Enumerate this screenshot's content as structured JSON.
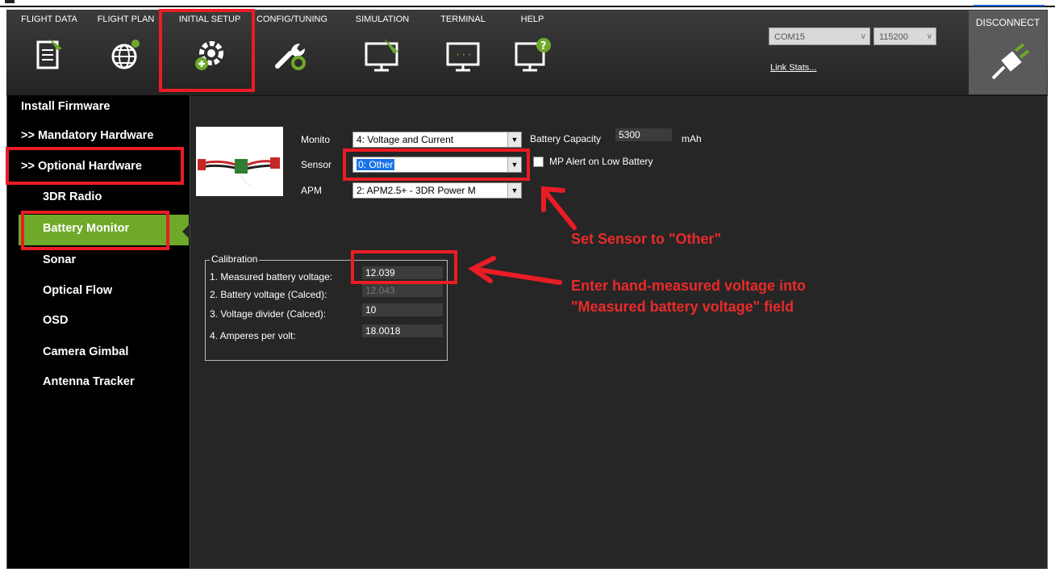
{
  "toolbar": {
    "items": [
      {
        "label": "FLIGHT DATA",
        "icon": "flight-data-icon"
      },
      {
        "label": "FLIGHT PLAN",
        "icon": "flight-plan-icon"
      },
      {
        "label": "INITIAL SETUP",
        "icon": "initial-setup-icon"
      },
      {
        "label": "CONFIG/TUNING",
        "icon": "config-tuning-icon"
      },
      {
        "label": "SIMULATION",
        "icon": "simulation-icon"
      },
      {
        "label": "TERMINAL",
        "icon": "terminal-icon"
      },
      {
        "label": "HELP",
        "icon": "help-icon"
      }
    ],
    "port": "COM15",
    "baud": "115200",
    "link_stats": "Link Stats...",
    "disconnect": "DISCONNECT"
  },
  "sidebar": {
    "items": [
      {
        "label": "Install Firmware"
      },
      {
        "label": ">> Mandatory Hardware"
      },
      {
        "label": ">> Optional Hardware"
      },
      {
        "label": "3DR Radio"
      },
      {
        "label": "Battery Monitor",
        "active": true
      },
      {
        "label": "Sonar"
      },
      {
        "label": "Optical Flow"
      },
      {
        "label": "OSD"
      },
      {
        "label": "Camera Gimbal"
      },
      {
        "label": "Antenna Tracker"
      }
    ]
  },
  "battery": {
    "monitor_label": "Monito",
    "monitor_value": "4: Voltage and Current",
    "sensor_label": "Sensor",
    "sensor_value": "0: Other",
    "apm_label": "APM",
    "apm_value": "2: APM2.5+ - 3DR Power M",
    "capacity_label": "Battery Capacity",
    "capacity_value": "5300",
    "capacity_unit": "mAh",
    "alert_label": "MP Alert on Low Battery",
    "alert_checked": false
  },
  "calibration": {
    "title": "Calibration",
    "rows": [
      {
        "label": "1. Measured battery voltage:",
        "value": "12.039"
      },
      {
        "label": "2. Battery voltage (Calced):",
        "value": "12.043"
      },
      {
        "label": "3. Voltage divider (Calced):",
        "value": "10"
      },
      {
        "label": "4. Amperes per volt:",
        "value": "18.0018"
      }
    ]
  },
  "annotations": {
    "sensor_note": "Set Sensor to \"Other\"",
    "voltage_note_line1": "Enter hand-measured voltage into",
    "voltage_note_line2": "\"Measured battery voltage\" field",
    "color": "#ea1c24"
  },
  "colors": {
    "active_green": "#6ea92a",
    "panel_bg": "#262626",
    "highlight_blue": "#1a73e8"
  }
}
